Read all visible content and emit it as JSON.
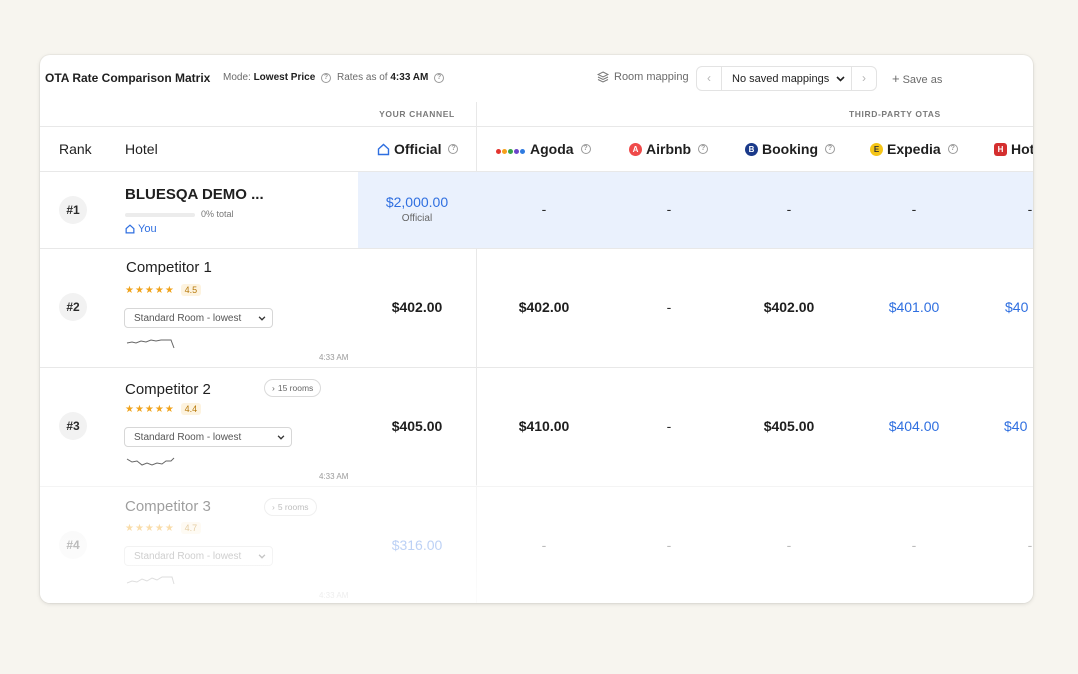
{
  "toolbar": {
    "title": "OTA Rate Comparison Matrix",
    "mode_label": "Mode:",
    "mode_value": "Lowest Price",
    "rates_label": "Rates as of",
    "rates_value": "4:33 AM",
    "room_mapping": "Room mapping",
    "mapping_select": "No saved mappings",
    "save_as": "Save as"
  },
  "groups": {
    "your_channel": "YOUR CHANNEL",
    "third_party": "THIRD-PARTY OTAS"
  },
  "columns": {
    "rank": "Rank",
    "hotel": "Hotel",
    "official": "Official",
    "otas": [
      {
        "name": "Agoda",
        "icon": "agoda-dots-icon"
      },
      {
        "name": "Airbnb",
        "icon": "airbnb-icon",
        "badge": "A",
        "color": "#ef4a4a"
      },
      {
        "name": "Booking",
        "icon": "booking-icon",
        "badge": "B",
        "color": "#1b3a8a"
      },
      {
        "name": "Expedia",
        "icon": "expedia-icon",
        "badge": "E",
        "color": "#f5c518"
      },
      {
        "name": "Hot",
        "icon": "hotels-icon",
        "badge": "H",
        "color": "#d42f2f"
      }
    ]
  },
  "rows": [
    {
      "rank": "#1",
      "hotel": "BLUESQA DEMO ...",
      "progress_label": "0% total",
      "progress": 0,
      "you_label": "You",
      "official": "$2,000.00",
      "official_sub": "Official",
      "ota": [
        "-",
        "-",
        "-",
        "-",
        "-"
      ]
    },
    {
      "rank": "#2",
      "hotel": "Competitor 1",
      "stars": "★★★★★",
      "rating": "4.5",
      "room_select": "Standard Room - lowest",
      "time": "4:33 AM",
      "official": "$402.00",
      "ota": [
        "$402.00",
        "-",
        "$402.00",
        "$401.00",
        "$40"
      ]
    },
    {
      "rank": "#3",
      "hotel": "Competitor 2",
      "rooms": "15 rooms",
      "stars": "★★★★★",
      "rating": "4.4",
      "room_select": "Standard Room - lowest",
      "time": "4:33 AM",
      "official": "$405.00",
      "ota": [
        "$410.00",
        "-",
        "$405.00",
        "$404.00",
        "$40"
      ]
    },
    {
      "rank": "#4",
      "hotel": "Competitor 3",
      "rooms": "5 rooms",
      "stars": "★★★★★",
      "rating": "4.7",
      "room_select": "Standard Room - lowest",
      "time": "4:33 AM",
      "official": "$316.00",
      "ota": [
        "-",
        "-",
        "-",
        "-",
        "-"
      ]
    }
  ],
  "colors": {
    "accent": "#2f6fe0",
    "highlight": "#eaf1fd",
    "star": "#f0a31c"
  }
}
